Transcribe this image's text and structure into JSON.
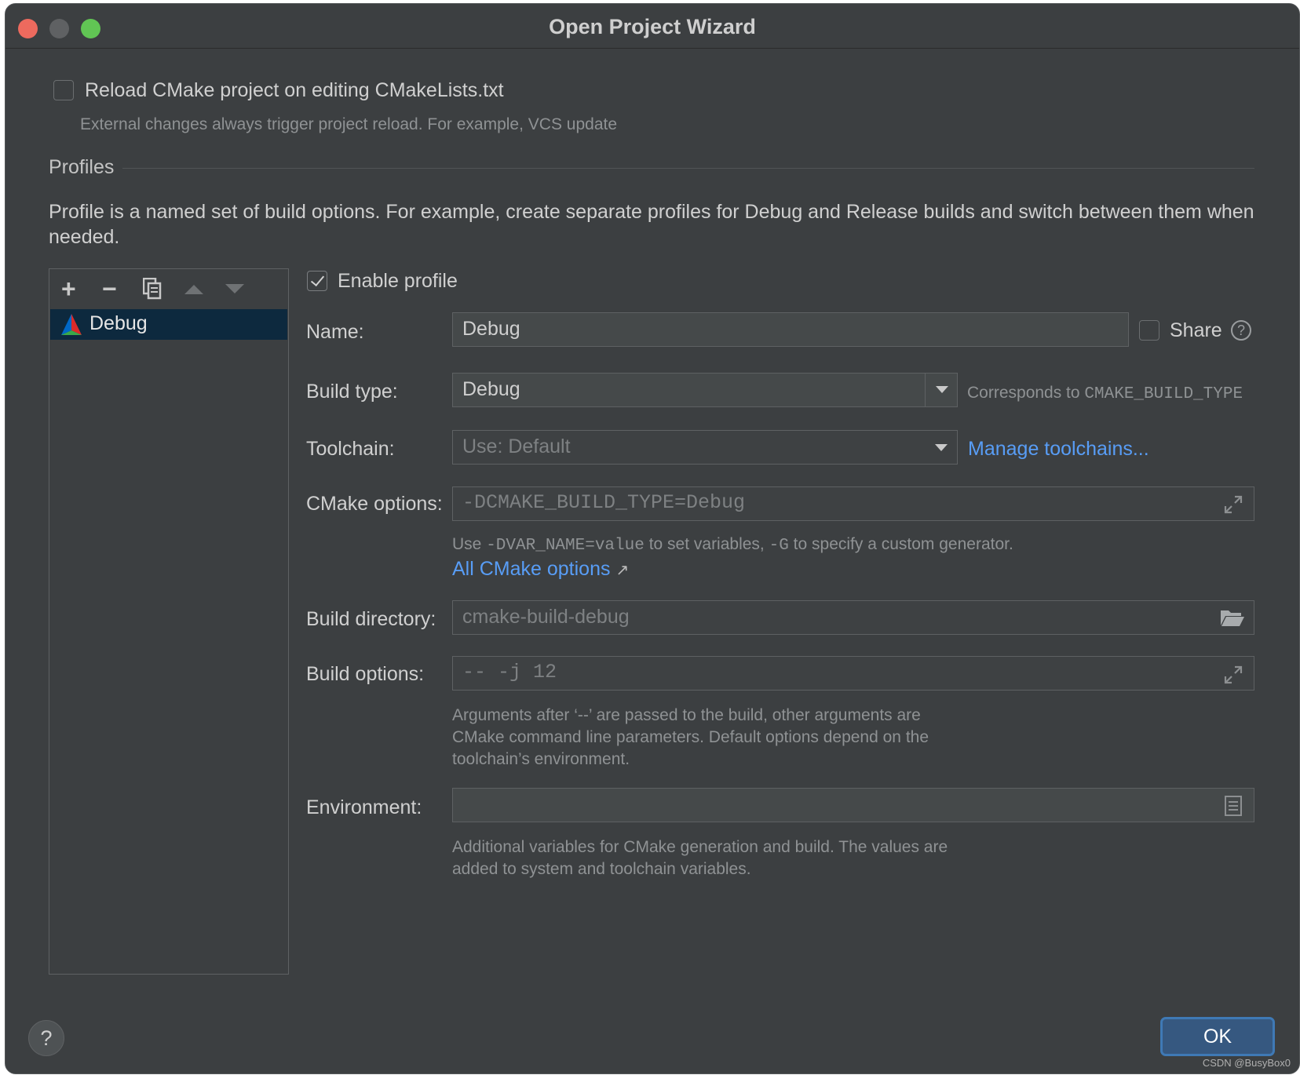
{
  "window": {
    "title": "Open Project Wizard"
  },
  "reload": {
    "label": "Reload CMake project on editing CMakeLists.txt",
    "checked": false,
    "hint": "External changes always trigger project reload. For example, VCS update"
  },
  "profiles": {
    "section_title": "Profiles",
    "description": "Profile is a named set of build options. For example, create separate profiles for Debug and Release builds and switch between them when needed.",
    "toolbar": [
      "add-icon",
      "remove-icon",
      "copy-icon",
      "move-up-icon",
      "move-down-icon"
    ],
    "toolbar_glyphs": {
      "add": "+",
      "remove": "−"
    },
    "items": [
      {
        "label": "Debug",
        "selected": true
      }
    ]
  },
  "form": {
    "enable_profile_label": "Enable profile",
    "enable_profile_checked": true,
    "name_label": "Name:",
    "name_value": "Debug",
    "share_label": "Share",
    "share_checked": false,
    "help_glyph": "?",
    "build_type_label": "Build type:",
    "build_type_value": "Debug",
    "build_type_hint_prefix": "Corresponds to",
    "build_type_hint_code": "CMAKE_BUILD_TYPE",
    "toolchain_label": "Toolchain:",
    "toolchain_value": "Use: Default",
    "manage_toolchains_link": "Manage toolchains...",
    "cmake_options_label": "CMake options:",
    "cmake_options_placeholder": "-DCMAKE_BUILD_TYPE=Debug",
    "cmake_hint": {
      "prefix": "Use",
      "code1": "-DVAR_NAME=value",
      "middle": "to set variables,",
      "code2": "-G",
      "suffix": "to specify a custom generator."
    },
    "all_cmake_options_link": "All CMake options",
    "all_cmake_options_arrow": "↗",
    "build_directory_label": "Build directory:",
    "build_directory_placeholder": "cmake-build-debug",
    "build_options_label": "Build options:",
    "build_options_placeholder": "-- -j 12",
    "build_options_hint": [
      "Arguments after ‘--’ are passed to the build, other arguments are",
      "CMake command line parameters. Default options depend on the",
      "toolchain’s environment."
    ],
    "environment_label": "Environment:",
    "environment_value": "",
    "environment_hint": [
      "Additional variables for CMake generation and build. The values are",
      "added to system and toolchain variables."
    ]
  },
  "footer": {
    "help_glyph": "?",
    "ok_label": "OK"
  },
  "watermark": "CSDN @BusyBox0",
  "colors": {
    "link": "#589df6",
    "selection": "#0d293e",
    "ok_button": "#365880",
    "background": "#3c3f41"
  }
}
